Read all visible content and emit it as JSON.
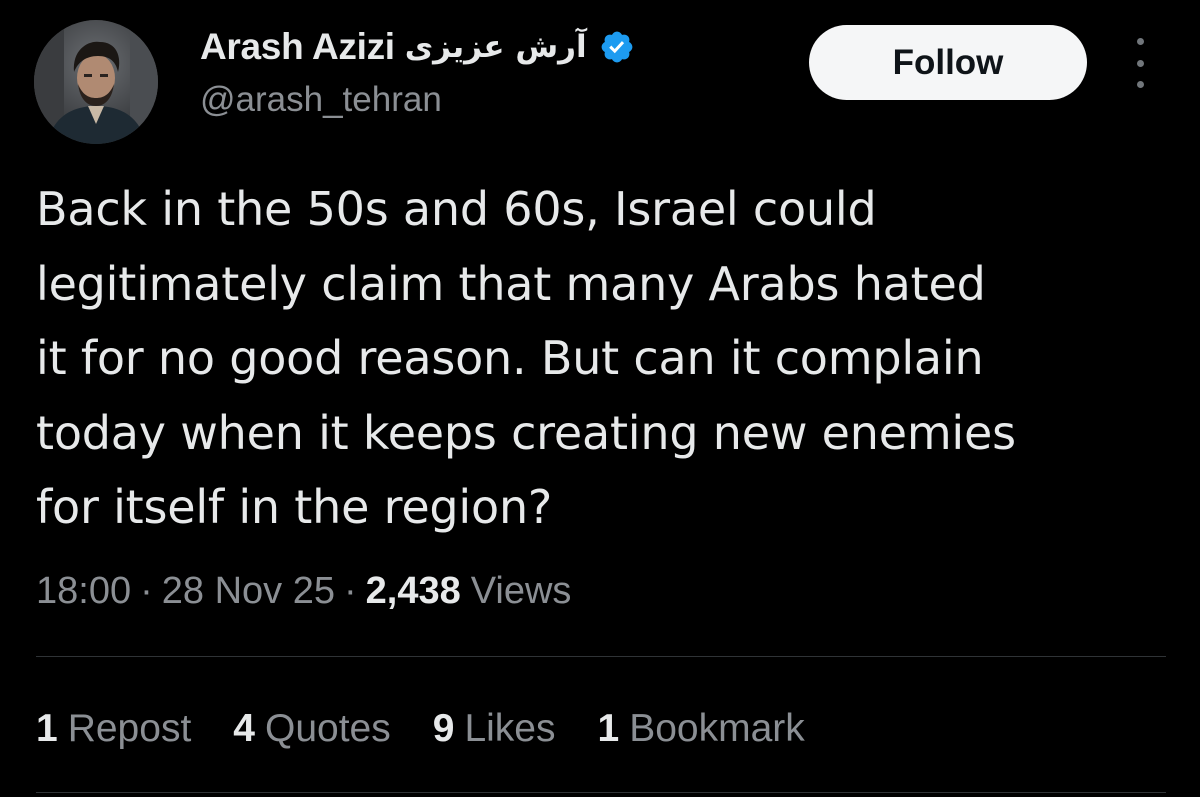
{
  "author": {
    "display_name": "Arash Azizi",
    "display_name_persian": "آرش عزیزی",
    "handle": "@arash_tehran",
    "verified_icon": "verified-badge-icon",
    "verified_color": "#1d9bf0"
  },
  "actions": {
    "follow_label": "Follow",
    "more_icon": "more-vertical-icon"
  },
  "tweet": {
    "lines": [
      "Back in the 50s and 60s, Israel could",
      "legitimately claim that many Arabs hated",
      "it for no good reason. But can it complain",
      "today when it keeps creating new enemies",
      "for itself in the region?"
    ]
  },
  "meta": {
    "time": "18:00",
    "separator": "·",
    "date": "28 Nov 25",
    "views_count": "2,438",
    "views_label": "Views"
  },
  "stats": [
    {
      "count": "1",
      "label": "Repost"
    },
    {
      "count": "4",
      "label": "Quotes"
    },
    {
      "count": "9",
      "label": "Likes"
    },
    {
      "count": "1",
      "label": "Bookmark"
    }
  ],
  "colors": {
    "background": "#000000",
    "text_primary": "#e7e9ea",
    "text_secondary": "#8b8f94",
    "divider": "#2f3336",
    "follow_bg": "#f5f6f7",
    "follow_text": "#0f1419"
  }
}
